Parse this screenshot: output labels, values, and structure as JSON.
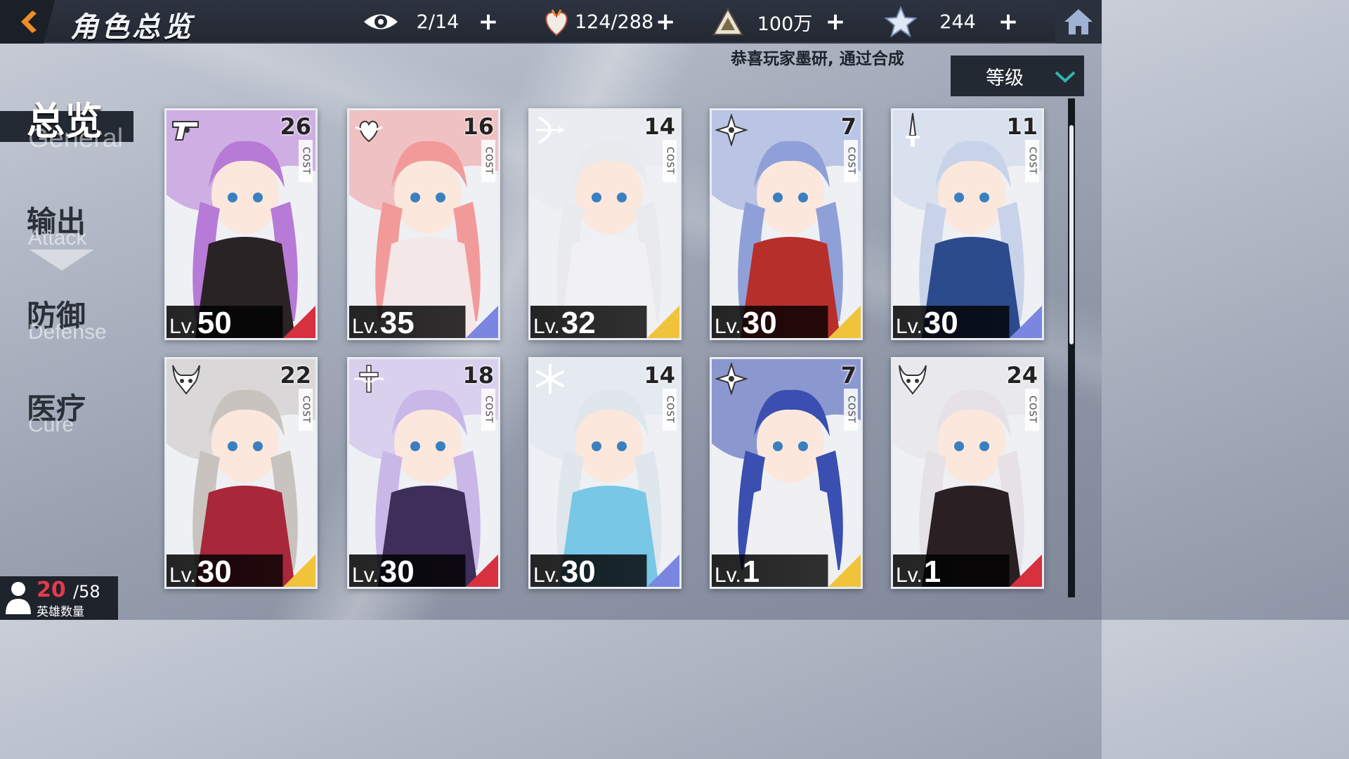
{
  "header": {
    "title": "角色总览",
    "back_icon": "back-arrow-icon",
    "home_icon": "home-icon",
    "resources": [
      {
        "icon": "eye-icon",
        "value": "2/14"
      },
      {
        "icon": "stamina-heart-icon",
        "value": "124/288"
      },
      {
        "icon": "gold-triangle-icon",
        "value": "100万"
      },
      {
        "icon": "star-crystal-icon",
        "value": "244"
      }
    ]
  },
  "notice": "恭喜玩家墨研, 通过合成",
  "sort": {
    "label": "等级",
    "icon": "chevron-down-icon"
  },
  "nav": {
    "general": {
      "cn": "总览",
      "en": "General"
    },
    "attack": {
      "cn": "输出",
      "en": "Attack"
    },
    "defense": {
      "cn": "防御",
      "en": "Defense"
    },
    "cure": {
      "cn": "医疗",
      "en": "Cure"
    }
  },
  "cards": [
    {
      "cost": "26",
      "cost_label": "COST",
      "lv_prefix": "Lv.",
      "level": "50",
      "type_icon": "revolver-icon",
      "tag_color": "#d7303f",
      "hair": "#b77ad6",
      "outfit": "#2a2326"
    },
    {
      "cost": "16",
      "cost_label": "COST",
      "lv_prefix": "Lv.",
      "level": "35",
      "type_icon": "heart-wing-icon",
      "tag_color": "#7a86e0",
      "hair": "#f29a9a",
      "outfit": "#f3e7e7"
    },
    {
      "cost": "14",
      "cost_label": "COST",
      "lv_prefix": "Lv.",
      "level": "32",
      "type_icon": "bow-icon",
      "tag_color": "#f0c33a",
      "hair": "#e9eaee",
      "outfit": "#f1f1f4"
    },
    {
      "cost": "7",
      "cost_label": "COST",
      "lv_prefix": "Lv.",
      "level": "30",
      "type_icon": "shuriken-icon",
      "tag_color": "#f0c33a",
      "hair": "#8fa0d8",
      "outfit": "#b72f2a"
    },
    {
      "cost": "11",
      "cost_label": "COST",
      "lv_prefix": "Lv.",
      "level": "30",
      "type_icon": "sword-icon",
      "tag_color": "#7a86e0",
      "hair": "#c8d3ea",
      "outfit": "#2c4b8c"
    },
    {
      "cost": "22",
      "cost_label": "COST",
      "lv_prefix": "Lv.",
      "level": "30",
      "type_icon": "horned-mask-icon",
      "tag_color": "#f0c33a",
      "hair": "#c9c3bf",
      "outfit": "#a8273a"
    },
    {
      "cost": "18",
      "cost_label": "COST",
      "lv_prefix": "Lv.",
      "level": "30",
      "type_icon": "winged-cross-icon",
      "tag_color": "#d7303f",
      "hair": "#c9b7e8",
      "outfit": "#3d2f59"
    },
    {
      "cost": "14",
      "cost_label": "COST",
      "lv_prefix": "Lv.",
      "level": "30",
      "type_icon": "snowflake-icon",
      "tag_color": "#7a86e0",
      "hair": "#dfe6ec",
      "outfit": "#78c7e6"
    },
    {
      "cost": "7",
      "cost_label": "COST",
      "lv_prefix": "Lv.",
      "level": "1",
      "type_icon": "shuriken-icon",
      "tag_color": "#f0c33a",
      "hair": "#3a4fb0",
      "outfit": "#f0f0f2"
    },
    {
      "cost": "24",
      "cost_label": "COST",
      "lv_prefix": "Lv.",
      "level": "1",
      "type_icon": "horned-mask-icon",
      "tag_color": "#d7303f",
      "hair": "#e6e1e6",
      "outfit": "#2a2024"
    }
  ],
  "hero_count": {
    "current": "20",
    "max": "/58",
    "label": "英雄数量",
    "icon": "person-icon"
  },
  "colors": {
    "accent": "#f08c2a",
    "count_red": "#e33a4c",
    "bar_dark": "#232933"
  }
}
